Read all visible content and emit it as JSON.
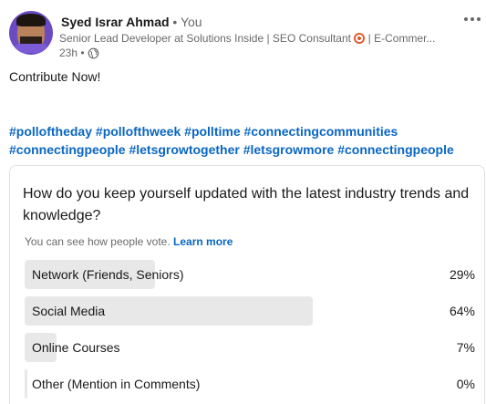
{
  "author": {
    "name": "Syed Israr Ahmad",
    "you_marker": " • You",
    "headline": "Senior Lead Developer at Solutions Inside | SEO Consultant",
    "headline_tail": "| E-Commer...",
    "time": "23h •"
  },
  "post": {
    "text": "Contribute Now!",
    "hashtags": [
      "#polloftheday",
      "#pollofthweek",
      "#polltime",
      "#connectingcommunities",
      "#connectingpeople",
      "#letsgrowtogether",
      "#letsgrowmore",
      "#connectingpeople"
    ]
  },
  "poll": {
    "question": "How do you keep yourself updated with the latest industry trends and knowledge?",
    "visibility_text": "You can see how people vote.",
    "learn_more": "Learn more",
    "options": [
      {
        "label": "Network (Friends, Seniors)",
        "percent_text": "29%",
        "percent": 29
      },
      {
        "label": "Social Media",
        "percent_text": "64%",
        "percent": 64
      },
      {
        "label": "Online Courses",
        "percent_text": "7%",
        "percent": 7
      },
      {
        "label": "Other (Mention in Comments)",
        "percent_text": "0%",
        "percent": 0
      }
    ]
  },
  "icons": {
    "more": "more-options-icon",
    "globe": "globe-icon",
    "target": "target-emoji-icon"
  },
  "colors": {
    "link": "#0a66c2",
    "bar_fill": "#e8e8e8",
    "secondary_text": "rgba(0,0,0,0.6)"
  }
}
